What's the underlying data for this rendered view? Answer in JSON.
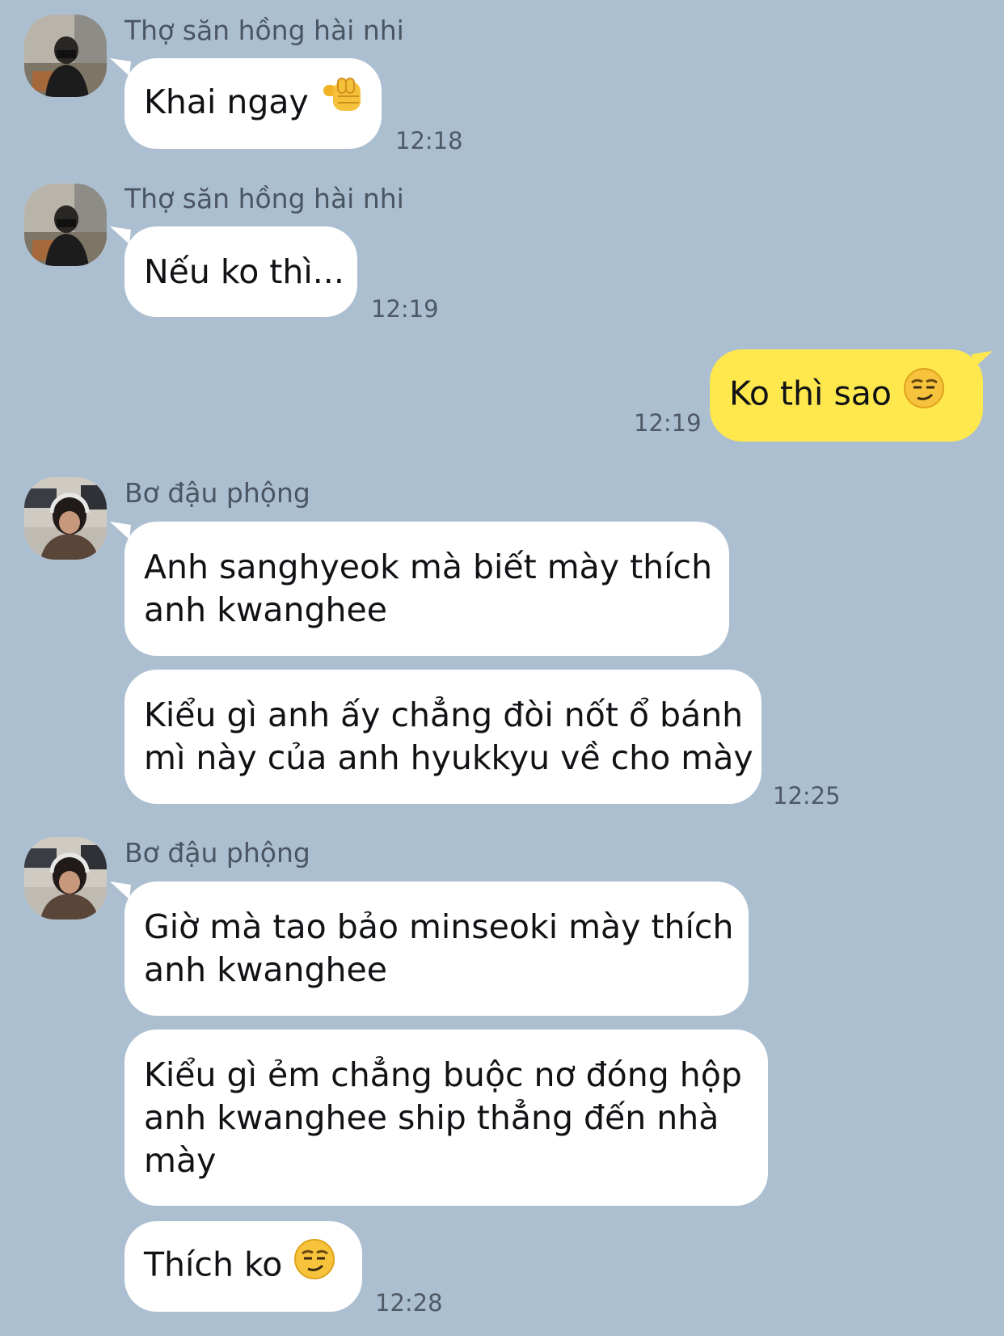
{
  "colors": {
    "chat_background": "#acbfd1",
    "incoming_bubble": "#ffffff",
    "outgoing_bubble": "#fee84d"
  },
  "messages": [
    {
      "sender": "Thợ săn hồng hài nhi",
      "lines": [
        "Khai ngay"
      ],
      "emoji": "pointing-fist-emoji",
      "time": "12:18"
    },
    {
      "sender": "Thợ săn hồng hài nhi",
      "lines": [
        "Nếu ko thì..."
      ],
      "time": "12:19"
    },
    {
      "lines": [
        "Ko thì sao"
      ],
      "emoji": "smirk-face-emoji",
      "time": "12:19"
    },
    {
      "sender": "Bơ đậu phộng",
      "lines": [
        "Anh sanghyeok mà biết mày thích",
        "anh kwanghee"
      ]
    },
    {
      "lines": [
        "Kiểu gì anh ấy chẳng đòi nốt ổ bánh",
        "mì này của anh hyukkyu về cho mày"
      ],
      "time": "12:25"
    },
    {
      "sender": "Bơ đậu phộng",
      "lines": [
        "Giờ mà tao bảo minseoki mày thích",
        "anh kwanghee"
      ]
    },
    {
      "lines": [
        "Kiểu gì ẻm chẳng buộc nơ đóng hộp",
        "anh kwanghee ship thẳng đến nhà",
        "mày"
      ]
    },
    {
      "lines": [
        "Thích ko"
      ],
      "emoji": "smirk-face-emoji",
      "time": "12:28"
    }
  ]
}
